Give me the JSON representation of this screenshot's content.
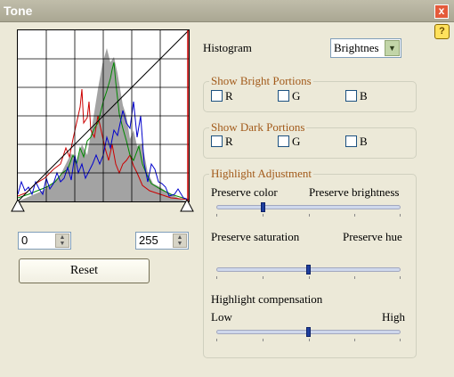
{
  "window": {
    "title": "Tone",
    "close_glyph": "x",
    "help_glyph": "?"
  },
  "histogram_panel": {
    "low_value": "0",
    "high_value": "255",
    "reset_label": "Reset"
  },
  "histogram_select": {
    "label": "Histogram",
    "value": "Brightness",
    "visible_value": "Brightnes"
  },
  "bright_portions": {
    "legend": "Show Bright Portions",
    "options": [
      "R",
      "G",
      "B"
    ]
  },
  "dark_portions": {
    "legend": "Show Dark Portions",
    "options": [
      "R",
      "G",
      "B"
    ]
  },
  "highlight": {
    "legend": "Highlight Adjustment",
    "slider1": {
      "left": "Preserve color",
      "right": "Preserve brightness",
      "level": 0.25
    },
    "slider2": {
      "left": "Preserve saturation",
      "right": "Preserve hue",
      "level": 0.5
    },
    "compensation": {
      "label": "Highlight compensation",
      "left": "Low",
      "right": "High",
      "level": 0.5
    }
  },
  "colors": {
    "red": "#c00000",
    "green": "#008000",
    "blue": "#0000c0",
    "gray": "#a0a0a0"
  }
}
